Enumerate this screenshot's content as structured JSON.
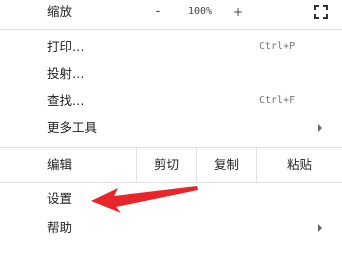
{
  "menu": {
    "zoom": {
      "label": "缩放",
      "minus": "-",
      "value": "100%",
      "plus": "+",
      "fullscreen_icon": "fullscreen-icon"
    },
    "print": {
      "label": "打印…",
      "shortcut": "Ctrl+P"
    },
    "cast": {
      "label": "投射…"
    },
    "find": {
      "label": "查找…",
      "shortcut": "Ctrl+F"
    },
    "more_tools": {
      "label": "更多工具"
    },
    "edit": {
      "label": "编辑",
      "cut": "剪切",
      "copy": "复制",
      "paste": "粘贴"
    },
    "settings": {
      "label": "设置"
    },
    "help": {
      "label": "帮助"
    }
  },
  "annotation": {
    "arrow_color": "#e8262a",
    "points_to": "settings"
  }
}
